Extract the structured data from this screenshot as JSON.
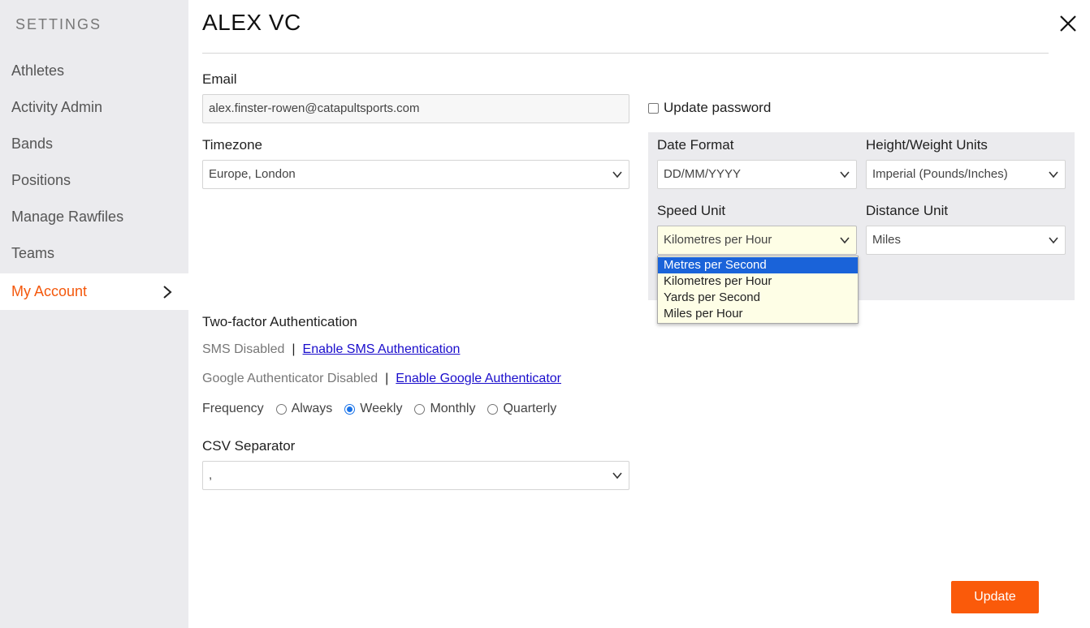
{
  "sidebar": {
    "title": "SETTINGS",
    "items": [
      {
        "label": "Athletes"
      },
      {
        "label": "Activity Admin"
      },
      {
        "label": "Bands"
      },
      {
        "label": "Positions"
      },
      {
        "label": "Manage Rawfiles"
      },
      {
        "label": "Teams"
      },
      {
        "label": "My Account",
        "active": true
      }
    ]
  },
  "header": {
    "title": "ALEX VC"
  },
  "form": {
    "email": {
      "label": "Email",
      "value": "alex.finster-rowen@catapultsports.com"
    },
    "timezone": {
      "label": "Timezone",
      "value": "Europe, London"
    },
    "update_password": {
      "label": "Update password",
      "checked": false
    },
    "date_format": {
      "label": "Date Format",
      "value": "DD/MM/YYYY"
    },
    "height_weight": {
      "label": "Height/Weight Units",
      "value": "Imperial (Pounds/Inches)"
    },
    "speed_unit": {
      "label": "Speed Unit",
      "value": "Kilometres per Hour",
      "options": [
        "Metres per Second",
        "Kilometres per Hour",
        "Yards per Second",
        "Miles per Hour"
      ],
      "highlighted_option": "Metres per Second"
    },
    "distance_unit": {
      "label": "Distance Unit",
      "value": "Miles"
    },
    "two_factor": {
      "title": "Two-factor Authentication",
      "sms_status": "SMS Disabled",
      "sms_link": "Enable SMS Authentication",
      "google_status": "Google Authenticator Disabled",
      "google_link": "Enable Google Authenticator",
      "separator": "|",
      "frequency_label": "Frequency",
      "frequency_options": [
        "Always",
        "Weekly",
        "Monthly",
        "Quarterly"
      ],
      "frequency_selected": "Weekly"
    },
    "csv_separator": {
      "label": "CSV Separator",
      "value": ","
    }
  },
  "footer": {
    "update_label": "Update"
  },
  "colors": {
    "accent": "#fa5a0a",
    "active_nav_text": "#f4580c",
    "sidebar_bg": "#ebebee",
    "dropdown_highlight": "#1a63d9",
    "link": "#1a0dcc"
  },
  "icons": {
    "nav_chevron": "chevron-right-icon",
    "close": "close-icon",
    "select_arrow": "chevron-down-icon"
  }
}
